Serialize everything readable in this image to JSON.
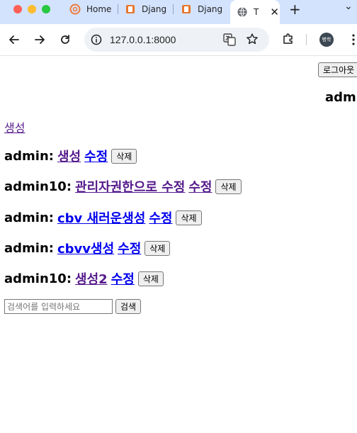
{
  "browser": {
    "tabs": [
      {
        "label": "Home"
      },
      {
        "label": "Djang"
      },
      {
        "label": "Djang"
      },
      {
        "label": "T"
      }
    ],
    "address": "127.0.0.1:8000",
    "profile_label": "병학"
  },
  "page": {
    "logout_label": "로그아웃",
    "username": "admin",
    "create_link": "생성",
    "posts": [
      {
        "author": "admin:",
        "title": "생성",
        "edit": "수정",
        "delete": "삭제"
      },
      {
        "author": "admin10:",
        "title": "관리자권한으로 수정",
        "edit": "수정",
        "delete": "삭제"
      },
      {
        "author": "admin:",
        "title": "cbv 새러운생성",
        "edit": "수정",
        "delete": "삭제"
      },
      {
        "author": "admin:",
        "title": "cbvv생성",
        "edit": "수정",
        "delete": "삭제"
      },
      {
        "author": "admin10:",
        "title": "생성2",
        "edit": "수정",
        "delete": "삭제"
      }
    ],
    "search": {
      "placeholder": "검색어를 입력하세요",
      "button": "검색"
    }
  },
  "colors": {
    "tabbar": "#d3e3fd",
    "visited_link": "#551a8b",
    "link": "#0000ee"
  }
}
